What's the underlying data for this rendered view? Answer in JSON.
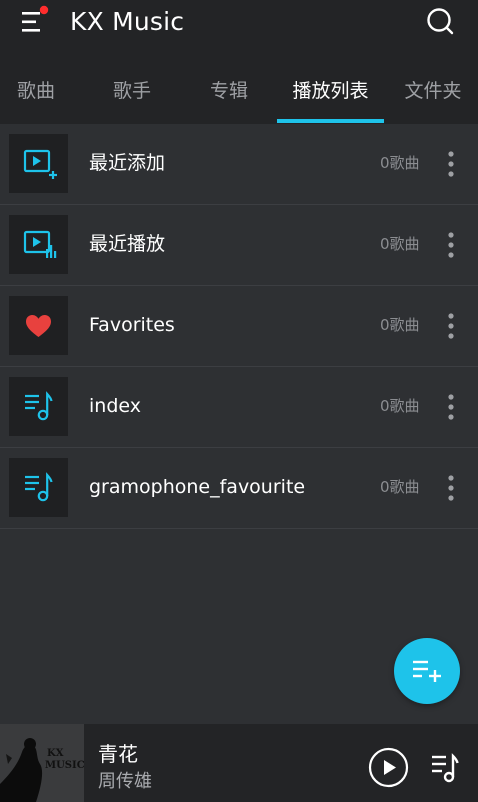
{
  "app": {
    "title": "KX Music"
  },
  "tabs": [
    {
      "label": "歌曲"
    },
    {
      "label": "歌手"
    },
    {
      "label": "专辑"
    },
    {
      "label": "播放列表"
    },
    {
      "label": "文件夹"
    }
  ],
  "playlists": [
    {
      "title": "最近添加",
      "count": "0歌曲",
      "icon": "playlist-add-icon"
    },
    {
      "title": "最近播放",
      "count": "0歌曲",
      "icon": "recently-played-icon"
    },
    {
      "title": "Favorites",
      "count": "0歌曲",
      "icon": "heart-icon"
    },
    {
      "title": "index",
      "count": "0歌曲",
      "icon": "music-list-icon"
    },
    {
      "title": "gramophone_favourite",
      "count": "0歌曲",
      "icon": "music-list-icon"
    }
  ],
  "now_playing": {
    "title": "青花",
    "artist": "周传雄",
    "cover_text_line1": "KX",
    "cover_text_line2": "MUSIC"
  },
  "colors": {
    "accent": "#1ec3ea",
    "heart": "#e8413e",
    "notification_dot": "#ff2d2d"
  }
}
